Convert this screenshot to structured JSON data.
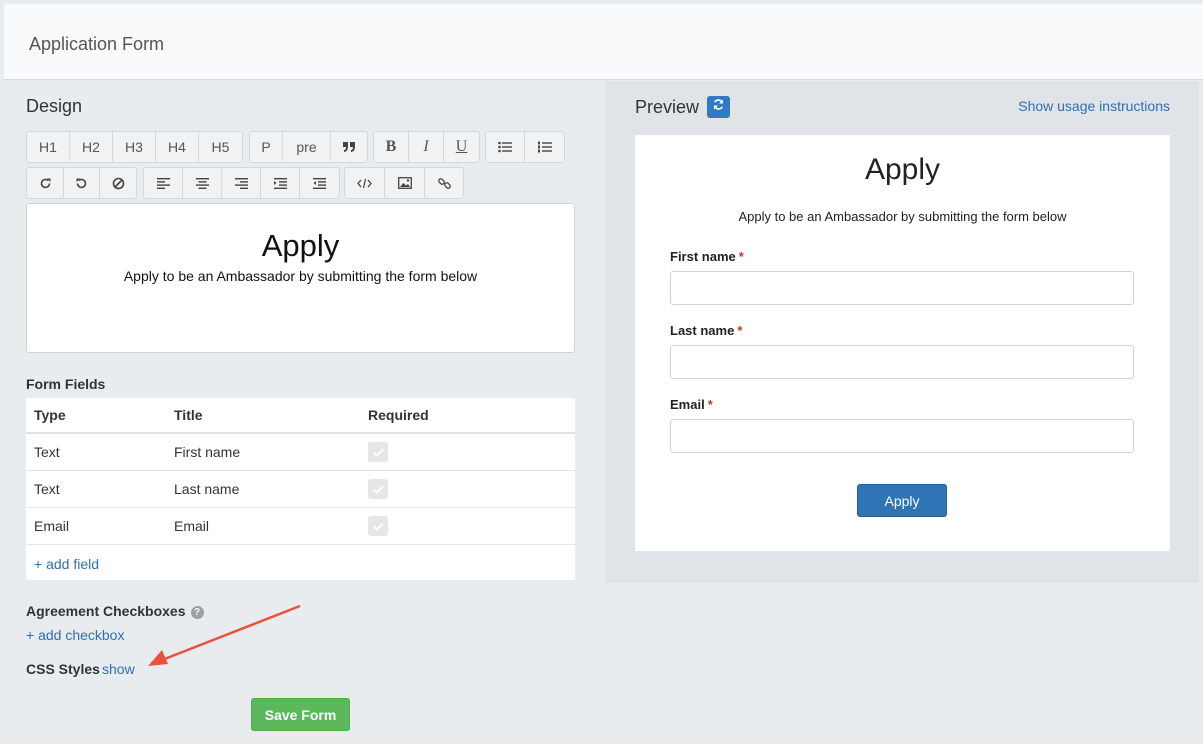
{
  "header": {
    "title": "Application Form"
  },
  "design": {
    "label": "Design",
    "toolbar_row1": [
      {
        "label": "H1",
        "name": "h1-button"
      },
      {
        "label": "H2",
        "name": "h2-button"
      },
      {
        "label": "H3",
        "name": "h3-button"
      },
      {
        "label": "H4",
        "name": "h4-button"
      },
      {
        "label": "H5",
        "name": "h5-button"
      },
      {
        "label": "P",
        "name": "paragraph-button"
      },
      {
        "label": "pre",
        "name": "pre-button"
      }
    ],
    "toolbar_icons": [
      "blockquote-icon",
      "bold-icon",
      "italic-icon",
      "underline-icon",
      "bullet-list-icon",
      "numbered-list-icon",
      "redo-icon",
      "undo-icon",
      "clear-format-icon",
      "align-left-icon",
      "align-center-icon",
      "align-right-icon",
      "indent-icon",
      "outdent-icon",
      "code-icon",
      "image-icon",
      "link-icon"
    ],
    "editor": {
      "heading": "Apply",
      "paragraph": "Apply to be an Ambassador by submitting the form below"
    }
  },
  "form_fields": {
    "label": "Form Fields",
    "columns": [
      "Type",
      "Title",
      "Required"
    ],
    "rows": [
      {
        "type": "Text",
        "title": "First name",
        "required": true
      },
      {
        "type": "Text",
        "title": "Last name",
        "required": true
      },
      {
        "type": "Email",
        "title": "Email",
        "required": true
      }
    ],
    "add_field": "+ add field"
  },
  "agreement": {
    "label": "Agreement Checkboxes",
    "help_icon": "?",
    "add_checkbox": "+ add checkbox"
  },
  "css_styles": {
    "label": "CSS Styles",
    "show_link": "show"
  },
  "save_button": "Save Form",
  "preview": {
    "label": "Preview",
    "usage_link": "Show usage instructions",
    "heading": "Apply",
    "paragraph": "Apply to be an Ambassador by submitting the form below",
    "fields": [
      {
        "label": "First name",
        "required_mark": "*"
      },
      {
        "label": "Last name",
        "required_mark": "*"
      },
      {
        "label": "Email",
        "required_mark": "*"
      }
    ],
    "apply_button": "Apply"
  },
  "colors": {
    "accent_blue": "#2f74b5",
    "save_green": "#5cb85c",
    "arrow_red": "#e8533f",
    "required_red": "#c0392b"
  }
}
